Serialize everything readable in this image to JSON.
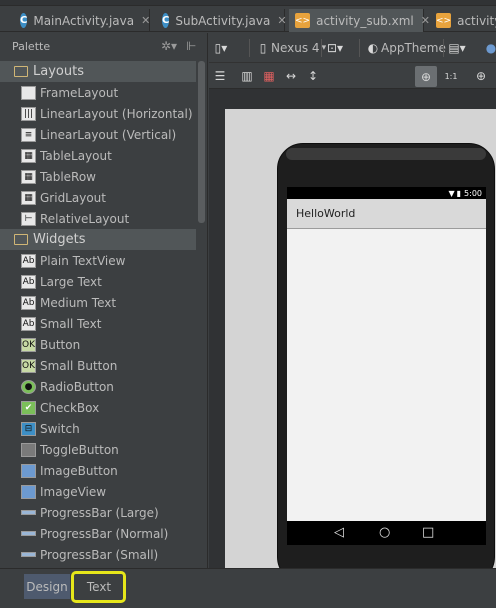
{
  "tabs": [
    {
      "label": "MainActivity.java",
      "kind": "java"
    },
    {
      "label": "SubActivity.java",
      "kind": "java"
    },
    {
      "label": "activity_sub.xml",
      "kind": "xml"
    },
    {
      "label": "activity_",
      "kind": "xml"
    }
  ],
  "palette": {
    "title": "Palette",
    "categories": [
      {
        "label": "Layouts",
        "items": [
          "FrameLayout",
          "LinearLayout (Horizontal)",
          "LinearLayout (Vertical)",
          "TableLayout",
          "TableRow",
          "GridLayout",
          "RelativeLayout"
        ]
      },
      {
        "label": "Widgets",
        "items": [
          "Plain TextView",
          "Large Text",
          "Medium Text",
          "Small Text",
          "Button",
          "Small Button",
          "RadioButton",
          "CheckBox",
          "Switch",
          "ToggleButton",
          "ImageButton",
          "ImageView",
          "ProgressBar (Large)",
          "ProgressBar (Normal)",
          "ProgressBar (Small)"
        ]
      }
    ]
  },
  "toolbar": {
    "device": "Nexus 4",
    "theme": "AppTheme"
  },
  "phone": {
    "status_time": "5:00",
    "app_title": "HelloWorld"
  },
  "bottom_tabs": {
    "design": "Design",
    "text": "Text"
  },
  "colors": {
    "highlight": "#e6e61a",
    "java_icon": "#3d8fc6",
    "xml_icon": "#e8a33d"
  }
}
